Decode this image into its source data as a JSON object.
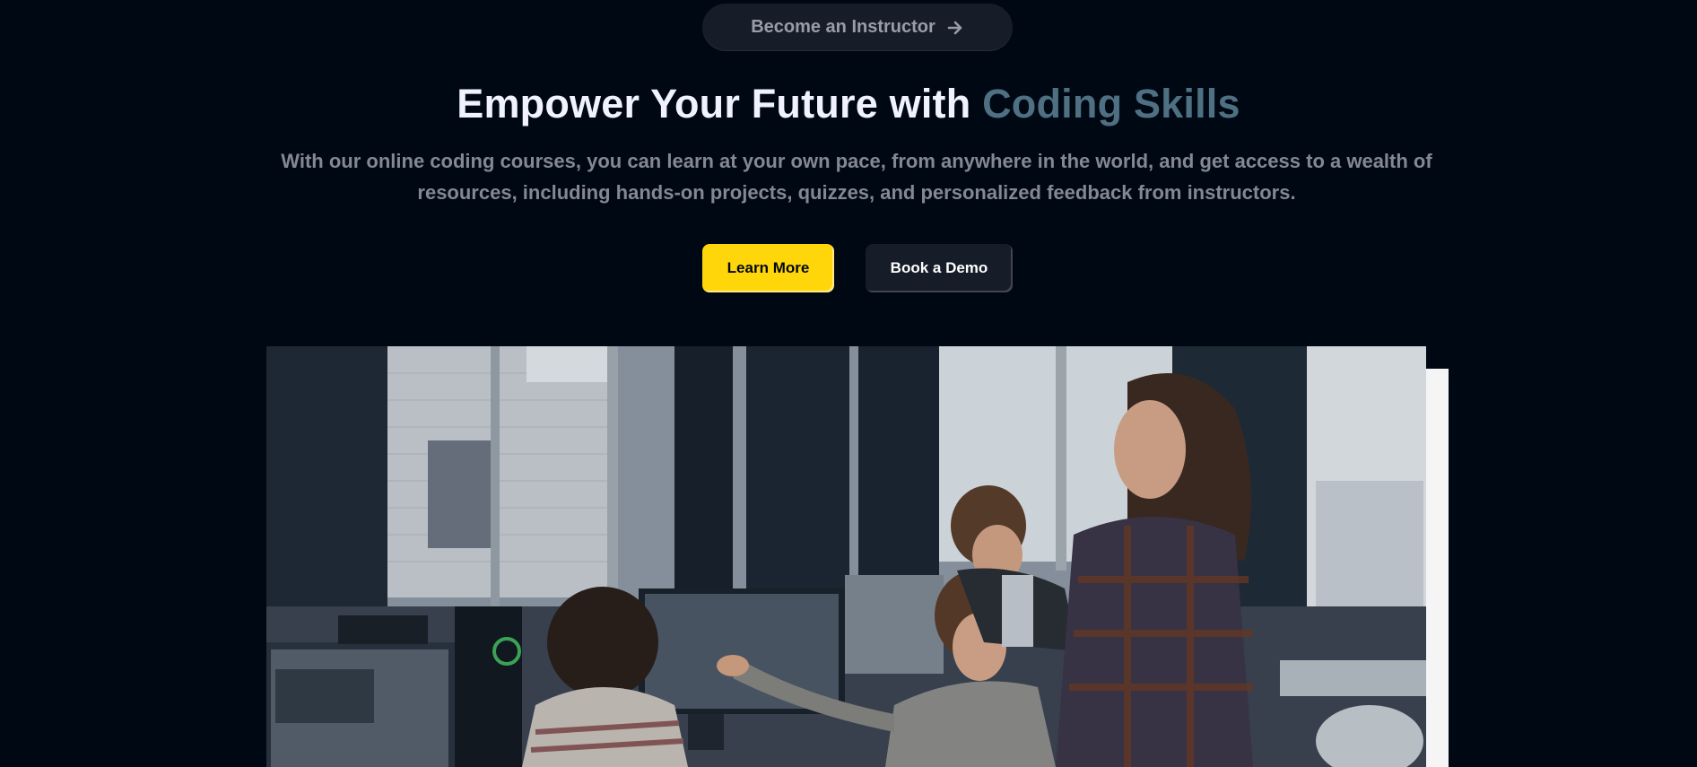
{
  "pill": {
    "label": "Become an Instructor",
    "icon": "arrow-right-icon"
  },
  "hero": {
    "title_main": "Empower Your Future with ",
    "title_accent": "Coding Skills",
    "subtitle": "With our online coding courses, you can learn at your own pace, from anywhere in the world, and get access to a wealth of resources, including hands-on projects, quizzes, and personalized feedback from instructors."
  },
  "buttons": {
    "learn_more": "Learn More",
    "book_demo": "Book a Demo"
  },
  "colors": {
    "background": "#000814",
    "accent_text": "#4f7082",
    "primary_button": "#ffd60a",
    "secondary_button": "#161d29"
  }
}
